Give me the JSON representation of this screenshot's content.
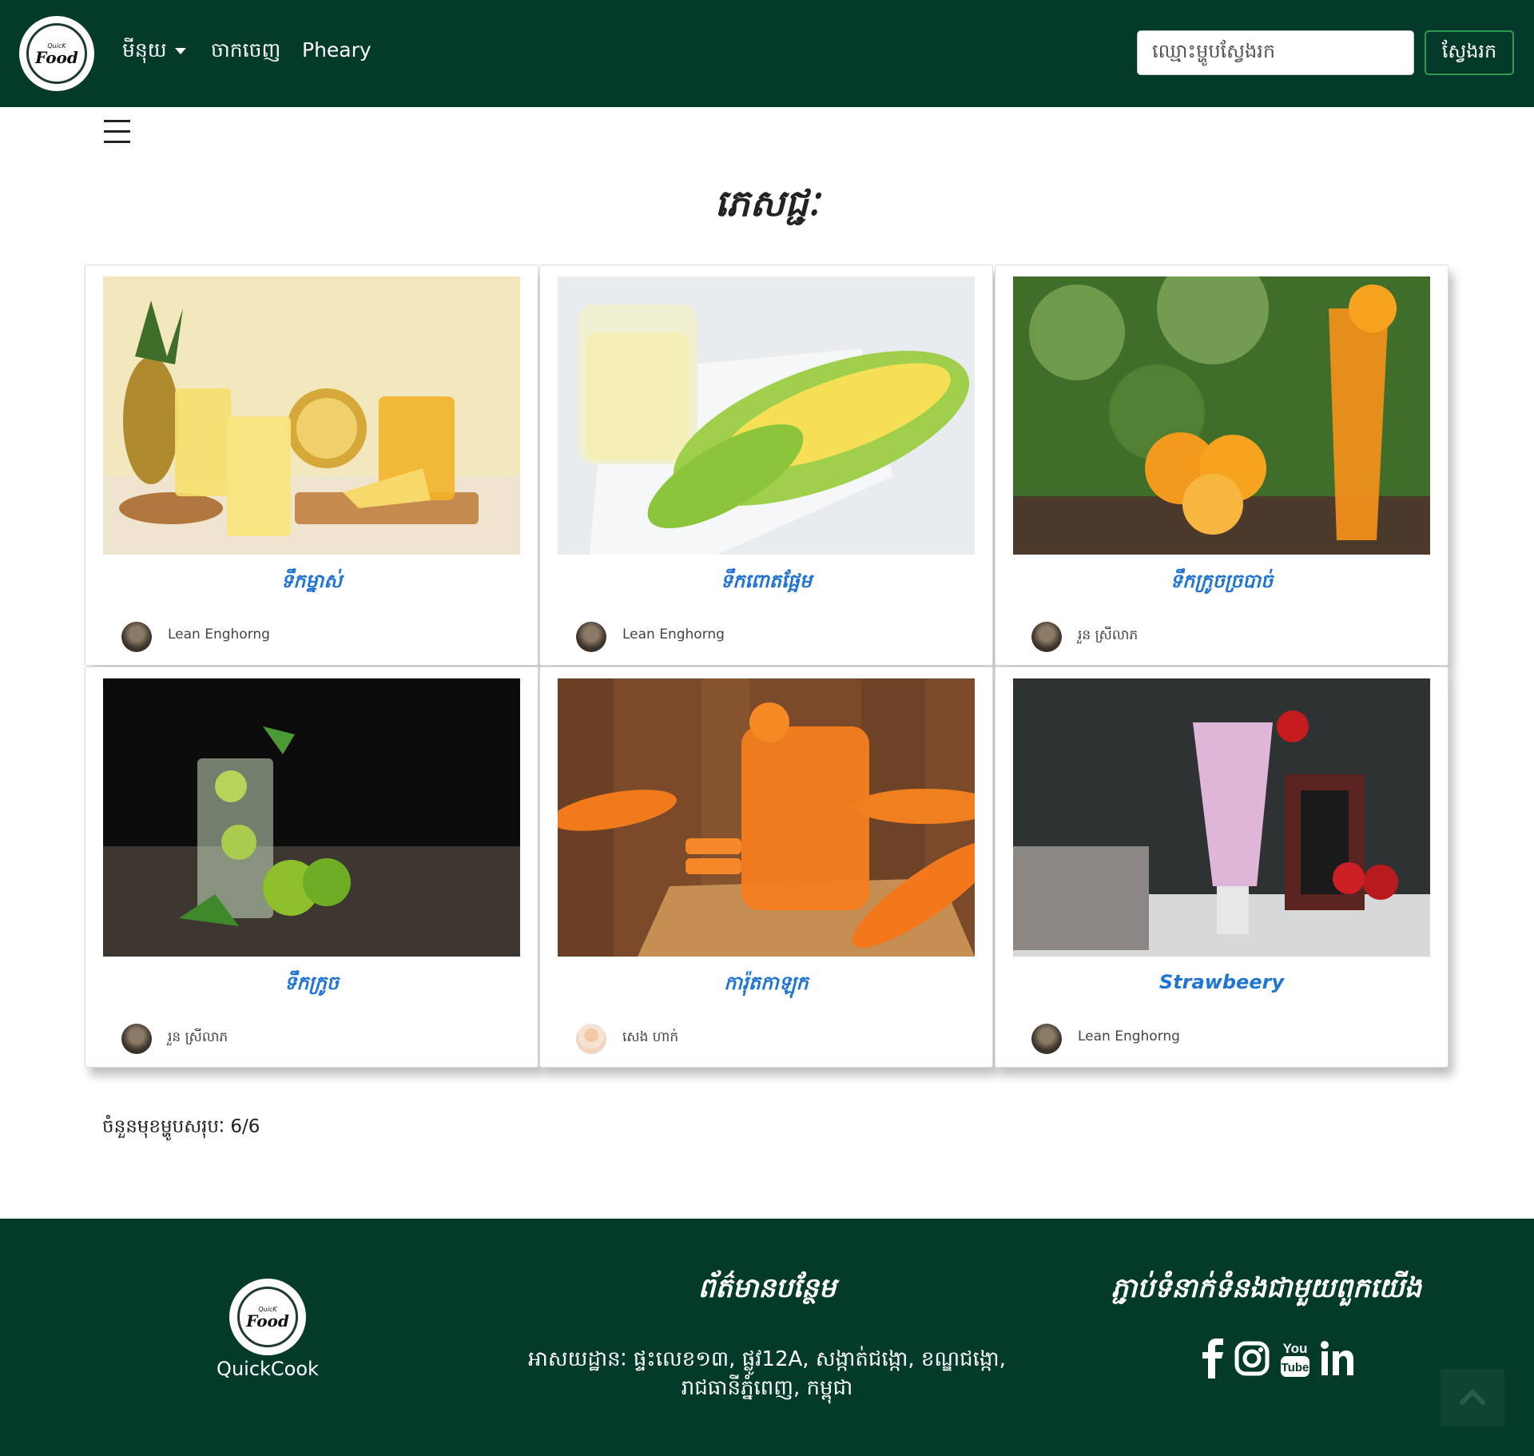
{
  "nav": {
    "logo_small": "QuicK",
    "logo_big": "Food",
    "menu_label": "មីនុយ",
    "logout_label": "ចាកចេញ",
    "user_name": "Pheary",
    "search_placeholder": "ឈ្មោះម្ហូបស្វែងរក",
    "search_button": "ស្វែងរក"
  },
  "page": {
    "title": "ភេសជ្ជៈ",
    "total_label": "ចំនួនមុខម្ហូបសរុបៈ 6/6"
  },
  "cards": [
    {
      "title": "ទឹកម្នាស់",
      "author": "Lean Enghorng",
      "image": "pineapple juice"
    },
    {
      "title": "ទឹកពោតផ្អែម",
      "author": "Lean Enghorng",
      "image": "corn milk"
    },
    {
      "title": "ទឹកក្រូចច្របាច់",
      "author": "រួន ស្រីលាភ",
      "image": "orange juice"
    },
    {
      "title": "ទឹកក្រូច",
      "author": "រួន ស្រីលាភ",
      "image": "lime drink"
    },
    {
      "title": "ការ៉ុតកាឡុក",
      "author": "សេង ហាក់",
      "image": "carrot juice"
    },
    {
      "title": "Strawbeery",
      "author": "Lean Enghorng",
      "image": "strawberry smoothie"
    }
  ],
  "footer": {
    "brand": "QuickCook",
    "info_heading": "ព័ត៌មានបន្ថែម",
    "address_line1": "អាសយដ្ឋានៈ ផ្ទះលេខ១៣, ផ្លូវ12A, សង្កាត់ជង្កោ, ខណ្ឌជង្កោ,",
    "address_line2": "រាជធានីភ្នំពេញ, កម្ពុជា",
    "contact_heading": "ភ្ជាប់ទំនាក់ទំនងជាមួយពួកយើង",
    "social_icons": [
      "facebook-icon",
      "instagram-icon",
      "youtube-icon",
      "linkedin-icon"
    ]
  },
  "colors": {
    "nav_bg": "#033a29",
    "card_title": "#1f74d4",
    "search_btn_border": "#2e9b52"
  }
}
